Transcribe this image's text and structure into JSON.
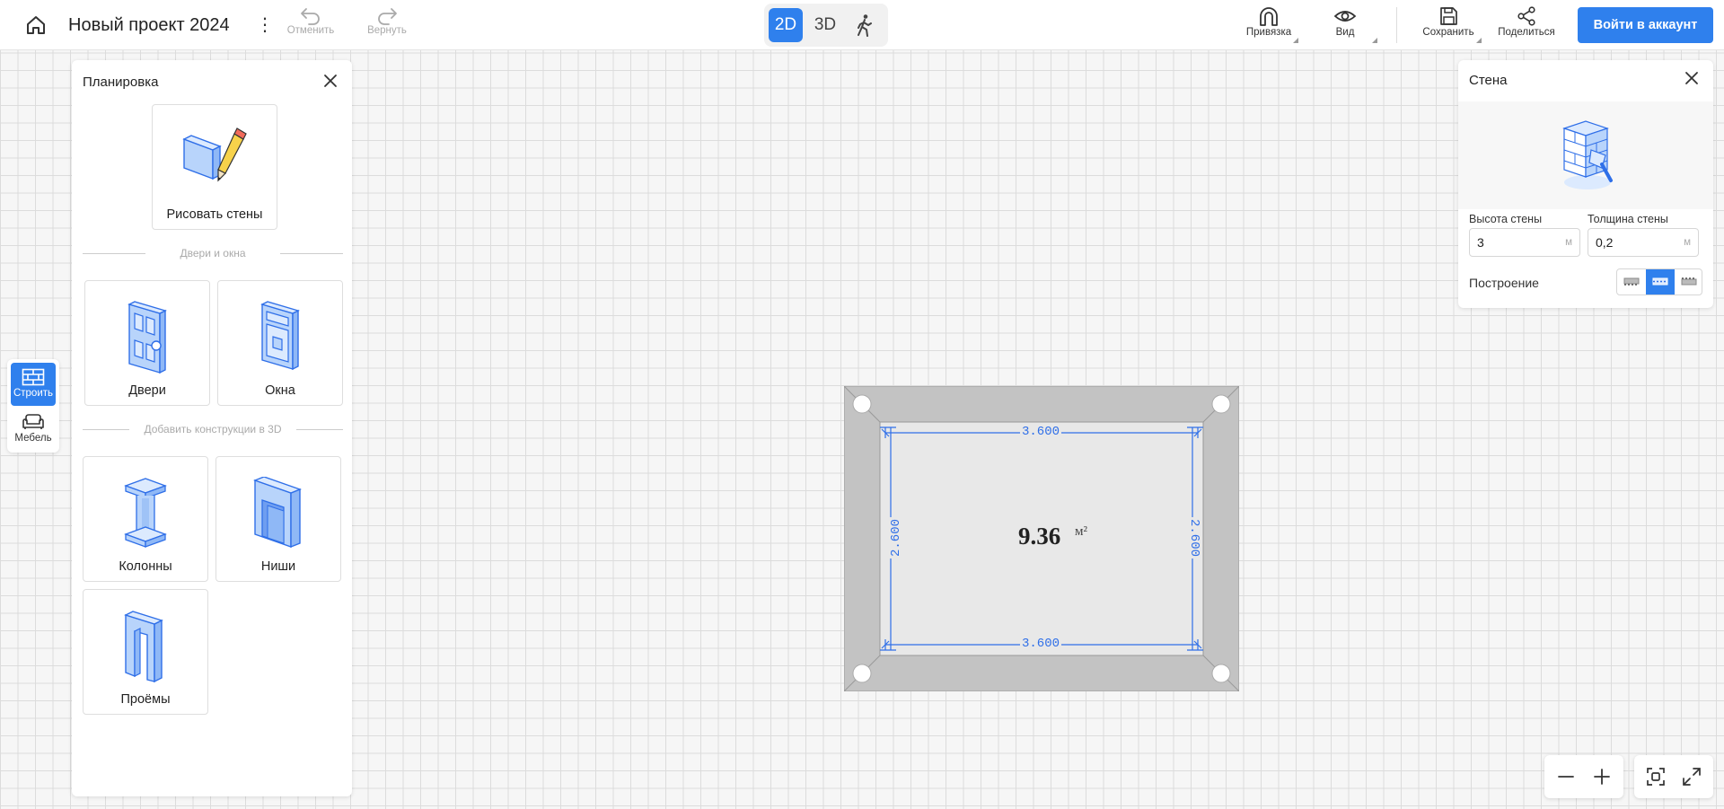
{
  "header": {
    "project_title": "Новый проект 2024",
    "undo_label": "Отменить",
    "redo_label": "Вернуть",
    "view_modes": [
      "2D",
      "3D"
    ],
    "active_view_mode": "2D",
    "snap_label": "Привязка",
    "view_label": "Вид",
    "save_label": "Сохранить",
    "share_label": "Поделиться",
    "login_label": "Войти в аккаунт",
    "accent_color": "#2f80ed"
  },
  "side_tabs": [
    {
      "label": "Строить",
      "icon": "brick-wall-icon",
      "active": true
    },
    {
      "label": "Мебель",
      "icon": "sofa-icon",
      "active": false
    }
  ],
  "plan_panel": {
    "title": "Планировка",
    "draw_walls_label": "Рисовать стены",
    "section_doors_windows": "Двери и окна",
    "doors_label": "Двери",
    "windows_label": "Окна",
    "section_3d": "Добавить конструкции в 3D",
    "columns_label": "Колонны",
    "niches_label": "Ниши",
    "openings_label": "Проёмы"
  },
  "wall_panel": {
    "title": "Стена",
    "height_label": "Высота стены",
    "height_value": "3",
    "height_unit": "м",
    "thickness_label": "Толщина стены",
    "thickness_value": "0,2",
    "thickness_unit": "м",
    "build_label": "Построение",
    "build_options": [
      "wall-inner-icon",
      "wall-center-icon",
      "wall-outer-icon"
    ],
    "build_selected": 1
  },
  "room": {
    "area_value": "9.36",
    "area_unit": "м²",
    "dim_top": "3.600",
    "dim_bottom": "3.600",
    "dim_left": "2.600",
    "dim_right": "2.600"
  }
}
